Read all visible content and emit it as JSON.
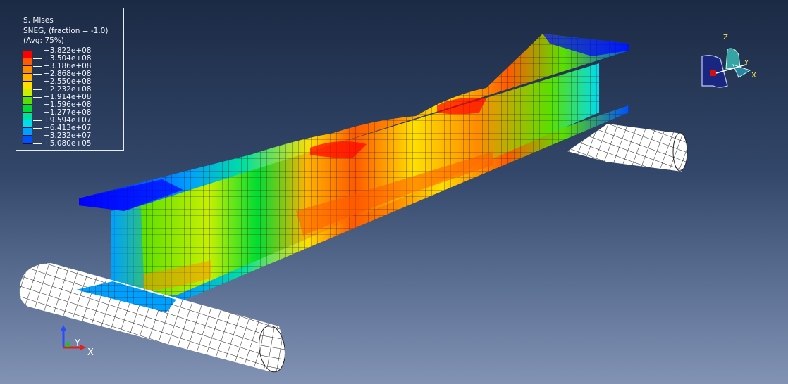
{
  "legend": {
    "title": "S, Mises",
    "subtitle": "SNEG, (fraction = -1.0)",
    "avg": "(Avg: 75%)",
    "entries": [
      {
        "value": "+3.822e+08",
        "color": "#ff0000"
      },
      {
        "value": "+3.504e+08",
        "color": "#ff5a00"
      },
      {
        "value": "+3.186e+08",
        "color": "#ff8c00"
      },
      {
        "value": "+2.868e+08",
        "color": "#ffb400"
      },
      {
        "value": "+2.550e+08",
        "color": "#ffe000"
      },
      {
        "value": "+2.232e+08",
        "color": "#c8f000"
      },
      {
        "value": "+1.914e+08",
        "color": "#5ae000"
      },
      {
        "value": "+1.596e+08",
        "color": "#00dc32"
      },
      {
        "value": "+1.277e+08",
        "color": "#00e0a0"
      },
      {
        "value": "+9.594e+07",
        "color": "#00dcf0"
      },
      {
        "value": "+6.413e+07",
        "color": "#00a0ff"
      },
      {
        "value": "+3.232e+07",
        "color": "#0050ff"
      },
      {
        "value": "+5.080e+05",
        "color": "#0000ff"
      }
    ]
  },
  "triad_bottom": {
    "y": "Y",
    "x": "X"
  },
  "triad_top": {
    "z": "Z",
    "y": "Y",
    "x": "X"
  },
  "colors": {
    "background_top": "#1b2a44",
    "background_bottom": "#8293b4",
    "mesh_line": "#1a1a1a",
    "roller_fill": "#ffffff"
  }
}
